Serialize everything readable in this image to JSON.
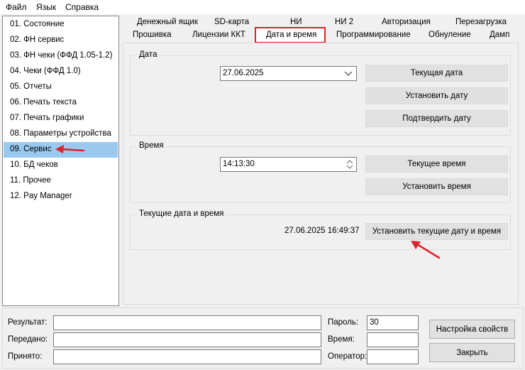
{
  "menu": {
    "file": "Файл",
    "language": "Язык",
    "help": "Справка"
  },
  "sidebar": {
    "items": [
      {
        "label": "01. Состояние"
      },
      {
        "label": "02. ФН сервис"
      },
      {
        "label": "03. ФН чеки (ФФД 1.05-1.2)"
      },
      {
        "label": "04. Чеки (ФФД 1.0)"
      },
      {
        "label": "05. Отчеты"
      },
      {
        "label": "06. Печать текста"
      },
      {
        "label": "07. Печать графики"
      },
      {
        "label": "08. Параметры устройства"
      },
      {
        "label": "09. Сервис"
      },
      {
        "label": "10. БД чеков"
      },
      {
        "label": "11. Прочее"
      },
      {
        "label": "12. Pay Manager"
      }
    ],
    "selected_index": 8
  },
  "tabs": {
    "row1": [
      "Денежный ящик",
      "SD-карта",
      "НИ",
      "НИ 2",
      "Авторизация",
      "Перезагрузка"
    ],
    "row2": [
      "Прошивка",
      "Лицензии ККТ",
      "Дата и время",
      "Программирование",
      "Обнуление",
      "Дамп"
    ],
    "active": "Дата и время"
  },
  "date_group": {
    "title": "Дата",
    "date_value": "27.06.2025",
    "btn_current": "Текущая дата",
    "btn_set": "Установить дату",
    "btn_confirm": "Подтвердить дату"
  },
  "time_group": {
    "title": "Время",
    "time_value": "14:13:30",
    "btn_current": "Текущее время",
    "btn_set": "Установить время"
  },
  "current_group": {
    "title": "Текущие дата и время",
    "value": "27.06.2025  16:49:37",
    "btn_set": "Установить текущие дату и время"
  },
  "bottom": {
    "result_label": "Результат:",
    "result_value": "",
    "sent_label": "Передано:",
    "sent_value": "",
    "received_label": "Принято:",
    "received_value": "",
    "password_label": "Пароль:",
    "password_value": "30",
    "time_label": "Время:",
    "time_value": "",
    "operator_label": "Оператор:",
    "operator_value": "",
    "btn_settings": "Настройка свойств",
    "btn_close": "Закрыть"
  },
  "colors": {
    "selected_bg": "#99c9ef",
    "highlight": "#e0202a",
    "button_bg": "#e1e1e1"
  }
}
